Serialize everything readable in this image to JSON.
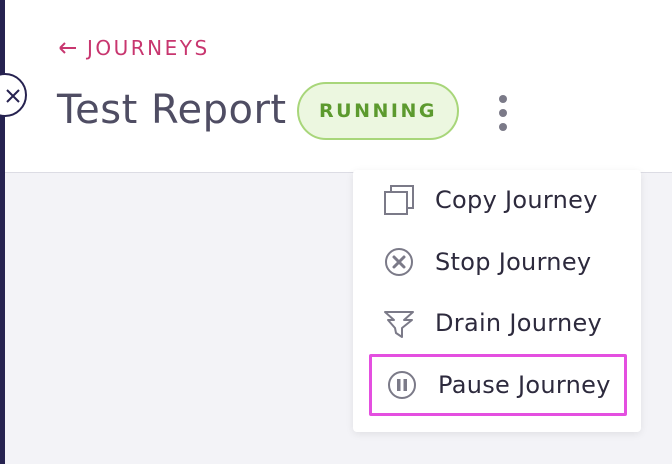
{
  "header": {
    "back_link": "JOURNEYS",
    "title": "Test Report",
    "status": "RUNNING"
  },
  "menu": {
    "items": [
      {
        "label": "Copy Journey",
        "icon": "copy-icon"
      },
      {
        "label": "Stop Journey",
        "icon": "stop-circle-icon"
      },
      {
        "label": "Drain Journey",
        "icon": "drain-funnel-icon"
      },
      {
        "label": "Pause Journey",
        "icon": "pause-circle-icon"
      }
    ],
    "highlighted_item": "Pause Journey"
  },
  "colors": {
    "accent": "#c8366f",
    "status_bg": "#ecf7e0",
    "status_border": "#a8d67a",
    "status_text": "#5c9a2e",
    "highlight": "#e44fe0",
    "rail": "#262250"
  }
}
